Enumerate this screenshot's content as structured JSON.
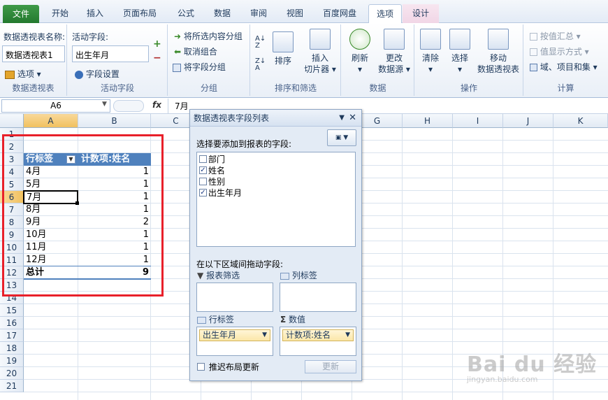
{
  "ribbon_tabs": {
    "file": "文件",
    "home": "开始",
    "insert": "插入",
    "page_layout": "页面布局",
    "formulas": "公式",
    "data": "数据",
    "review": "审阅",
    "view": "视图",
    "baidu_disk": "百度网盘",
    "options": "选项",
    "design": "设计"
  },
  "ribbon": {
    "pivot_name_label": "数据透视表名称:",
    "pivot_name_value": "数据透视表1",
    "options_btn": "选项",
    "group_pivot": "数据透视表",
    "active_field_label": "活动字段:",
    "active_field_value": "出生年月",
    "field_settings": "字段设置",
    "group_active_field": "活动字段",
    "group_selection": "将所选内容分组",
    "ungroup": "取消组合",
    "group_field": "将字段分组",
    "group_group": "分组",
    "sort": "排序",
    "insert_slicer_1": "插入",
    "insert_slicer_2": "切片器",
    "group_sort_filter": "排序和筛选",
    "refresh": "刷新",
    "change_source_1": "更改",
    "change_source_2": "数据源",
    "group_data": "数据",
    "clear": "清除",
    "select": "选择",
    "move_pivot_1": "移动",
    "move_pivot_2": "数据透视表",
    "group_actions": "操作",
    "summarize_by": "按值汇总",
    "show_values_as": "值显示方式",
    "fields_items_sets": "域、项目和集",
    "group_calculations": "计算"
  },
  "formula_bar": {
    "name_box": "A6",
    "fx": "fx",
    "value": "7月"
  },
  "columns": [
    "A",
    "B",
    "C",
    "D",
    "E",
    "F",
    "G",
    "H",
    "I",
    "J",
    "K"
  ],
  "rows": [
    "1",
    "2",
    "3",
    "4",
    "5",
    "6",
    "7",
    "8",
    "9",
    "10",
    "11",
    "12",
    "13",
    "14",
    "15",
    "16",
    "17",
    "18",
    "19",
    "20",
    "21"
  ],
  "pivot": {
    "row_label_header": "行标签",
    "value_header": "计数项:姓名",
    "rows": [
      {
        "label": "4月",
        "value": "1"
      },
      {
        "label": "5月",
        "value": "1"
      },
      {
        "label": "7月",
        "value": "1"
      },
      {
        "label": "8月",
        "value": "1"
      },
      {
        "label": "9月",
        "value": "2"
      },
      {
        "label": "10月",
        "value": "1"
      },
      {
        "label": "11月",
        "value": "1"
      },
      {
        "label": "12月",
        "value": "1"
      }
    ],
    "total_label": "总计",
    "total_value": "9"
  },
  "field_pane": {
    "title": "数据透视表字段列表",
    "choose_label": "选择要添加到报表的字段:",
    "fields": [
      {
        "name": "部门",
        "checked": false
      },
      {
        "name": "姓名",
        "checked": true
      },
      {
        "name": "性别",
        "checked": false
      },
      {
        "name": "出生年月",
        "checked": true
      }
    ],
    "drag_label": "在以下区域间拖动字段:",
    "report_filter": "报表筛选",
    "column_labels": "列标签",
    "row_labels": "行标签",
    "values": "数值",
    "row_field": "出生年月",
    "value_field": "计数项:姓名",
    "defer_update": "推迟布局更新",
    "update_btn": "更新"
  },
  "watermark": {
    "logo": "Bai du 经验",
    "url": "jingyan.baidu.com"
  }
}
